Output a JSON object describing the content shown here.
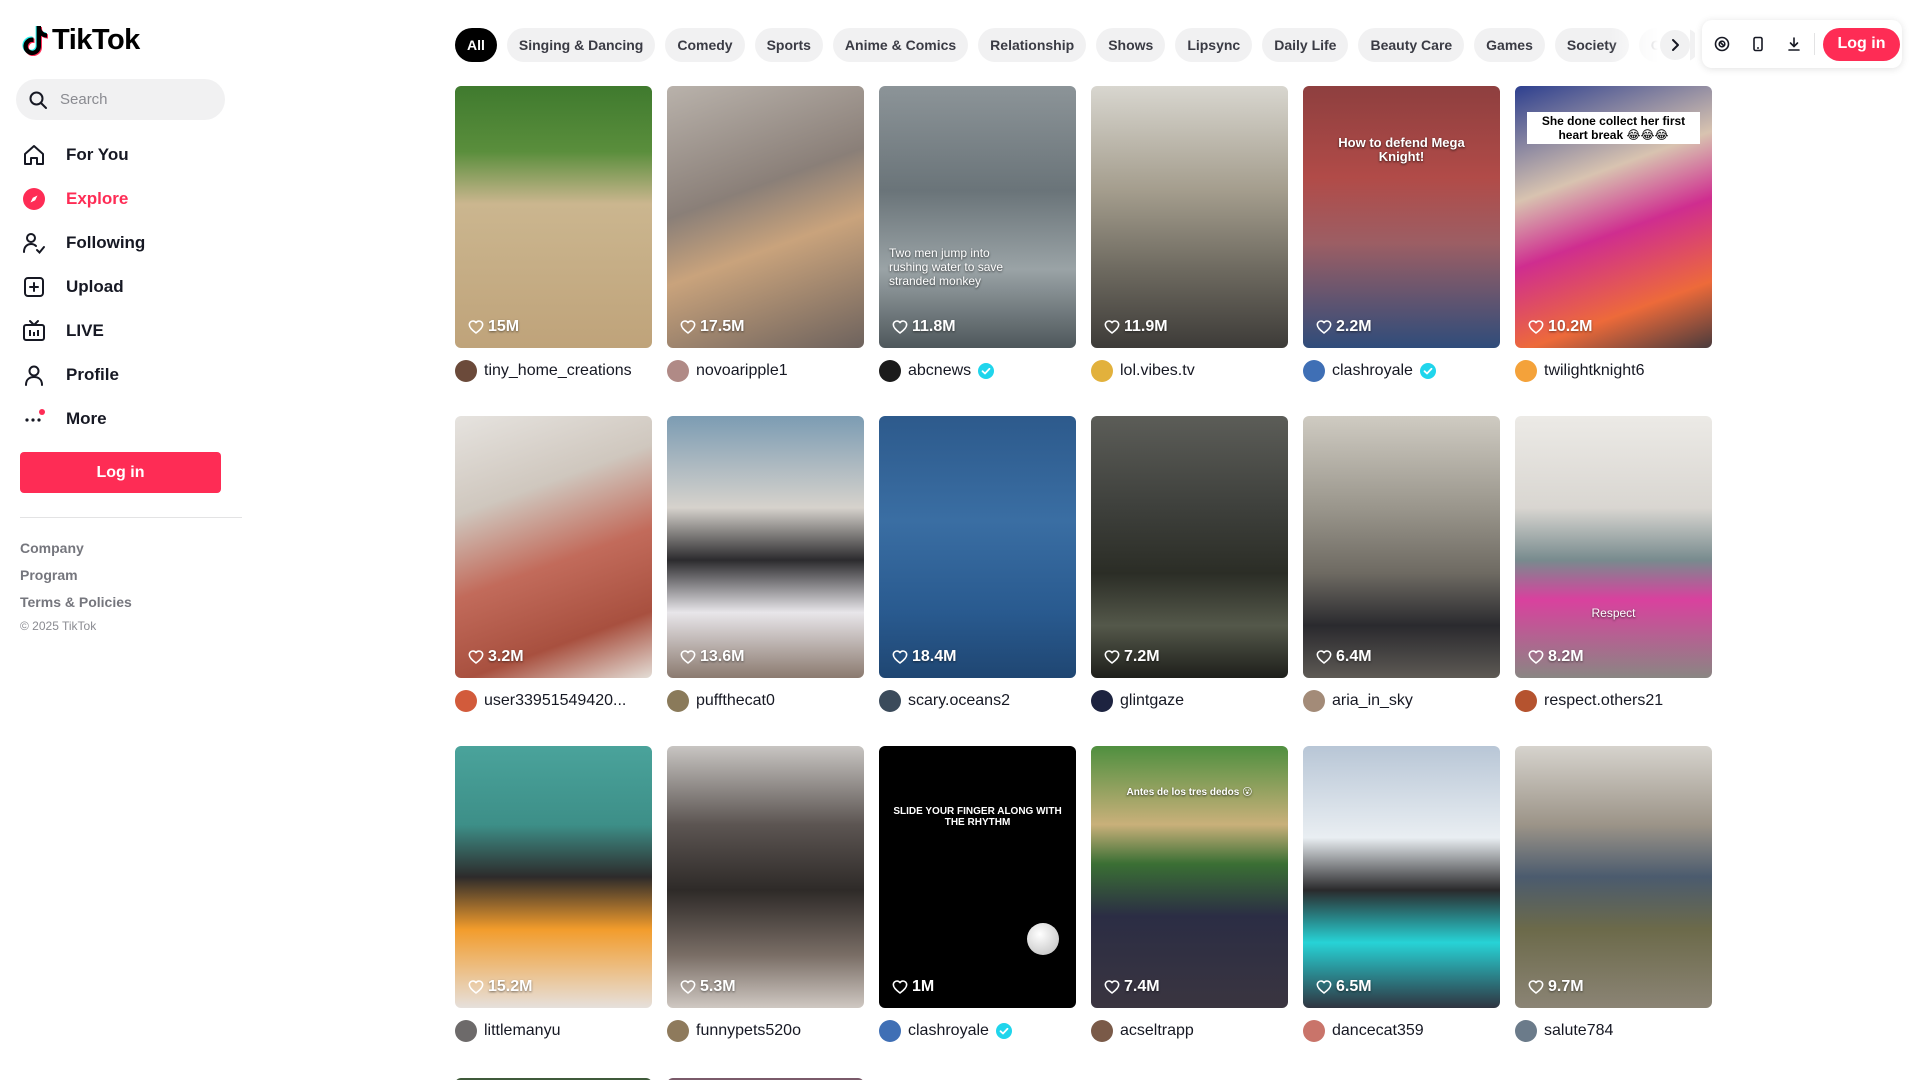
{
  "brand": {
    "name": "TikTok",
    "accent": "#fe2c55"
  },
  "search": {
    "placeholder": "Search"
  },
  "nav": [
    {
      "label": "For You",
      "icon": "home-icon",
      "active": false
    },
    {
      "label": "Explore",
      "icon": "compass-icon",
      "active": true
    },
    {
      "label": "Following",
      "icon": "following-icon",
      "active": false
    },
    {
      "label": "Upload",
      "icon": "upload-icon",
      "active": false
    },
    {
      "label": "LIVE",
      "icon": "live-icon",
      "active": false
    },
    {
      "label": "Profile",
      "icon": "profile-icon",
      "active": false
    },
    {
      "label": "More",
      "icon": "more-icon",
      "active": false
    }
  ],
  "sidebar": {
    "login_label": "Log in"
  },
  "footer": {
    "links": [
      "Company",
      "Program",
      "Terms & Policies"
    ],
    "copyright": "© 2025 TikTok"
  },
  "categories": [
    "All",
    "Singing & Dancing",
    "Comedy",
    "Sports",
    "Anime & Comics",
    "Relationship",
    "Shows",
    "Lipsync",
    "Daily Life",
    "Beauty Care",
    "Games",
    "Society",
    "Outfit"
  ],
  "active_category": "All",
  "header": {
    "login_label": "Log in"
  },
  "videos": [
    {
      "likes": "15M",
      "author": "tiny_home_creations",
      "verified": false,
      "overlay": "",
      "bg": "linear-gradient(180deg,#3f7a2e 0%,#5a8e3c 25%,#cbb68f 45%,#bfa37a 100%)",
      "avatar": "#6b4a3a"
    },
    {
      "likes": "17.5M",
      "author": "novoaripple1",
      "verified": false,
      "overlay": "",
      "bg": "linear-gradient(160deg,#b9b2ab 0%,#8a7f78 40%,#c9a37c 60%,#6d625d 100%)",
      "avatar": "#b08a86"
    },
    {
      "likes": "11.8M",
      "author": "abcnews",
      "verified": true,
      "overlay": "Two men jump into rushing water to save stranded monkey",
      "bg": "linear-gradient(180deg,#8c9498 0%,#6a7479 40%,#9aa3a6 70%,#4e575b 100%)",
      "avatar": "#1b1b1b"
    },
    {
      "likes": "11.9M",
      "author": "lol.vibes.tv",
      "verified": false,
      "overlay": "",
      "bg": "linear-gradient(180deg,#d8d6cf 0%,#a49d8d 40%,#6e6a60 70%,#3d3b38 100%)",
      "avatar": "#e2b13c"
    },
    {
      "likes": "2.2M",
      "author": "clashroyale",
      "verified": true,
      "overlay": "How to defend Mega Knight!",
      "bg": "linear-gradient(180deg,#8e3f3f 0%,#b14b48 35%,#9c5e64 60%,#2f4c7a 100%)",
      "avatar": "#3f6fb5"
    },
    {
      "likes": "10.2M",
      "author": "twilightknight6",
      "verified": false,
      "overlay": "She done collect her first heart break 😂😂😂",
      "bg": "linear-gradient(160deg,#2d3f8f 0%,#d8c3b0 35%,#cf2d8f 55%,#ed6a3a 80%,#4a3b3d 100%)",
      "avatar": "#f4a23a"
    },
    {
      "likes": "3.2M",
      "author": "user33951549420...",
      "verified": false,
      "overlay": "",
      "bg": "linear-gradient(160deg,#e6e3df 0%,#cfc7be 30%,#c26b5b 55%,#a8503f 80%,#e3ddd6 100%)",
      "avatar": "#d25b3b"
    },
    {
      "likes": "13.6M",
      "author": "puffthecat0",
      "verified": false,
      "overlay": "",
      "bg": "linear-gradient(180deg,#7c9cb3 0%,#d6d2cc 35%,#2c2b2e 55%,#e8e6ea 75%,#8b7a6f 100%)",
      "avatar": "#8a7a5a"
    },
    {
      "likes": "18.4M",
      "author": "scary.oceans2",
      "verified": false,
      "overlay": "",
      "bg": "linear-gradient(180deg,#2d5a8c 0%,#3a6ea3 40%,#295a8f 75%,#1f4672 100%)",
      "avatar": "#3b4b5b"
    },
    {
      "likes": "7.2M",
      "author": "glintgaze",
      "verified": false,
      "overlay": "",
      "bg": "linear-gradient(180deg,#5c5d58 0%,#3e403c 35%,#2b2d26 60%,#54584a 80%,#1e1f1b 100%)",
      "avatar": "#1d2340"
    },
    {
      "likes": "6.4M",
      "author": "aria_in_sky",
      "verified": false,
      "overlay": "",
      "bg": "linear-gradient(180deg,#cfcbc2 0%,#9a968c 35%,#6e6a62 60%,#2a2a2e 80%,#5d5954 100%)",
      "avatar": "#a38b78"
    },
    {
      "likes": "8.2M",
      "author": "respect.others21",
      "verified": false,
      "overlay": "Respect",
      "bg": "linear-gradient(180deg,#eceae6 0%,#d9d6d1 35%,#788b8e 55%,#d9419e 70%,#8a8683 100%)",
      "avatar": "#b5532f"
    },
    {
      "likes": "15.2M",
      "author": "littlemanyu",
      "verified": false,
      "overlay": "",
      "bg": "linear-gradient(180deg,#4aa39b 0%,#3d8f88 30%,#2d2b2b 50%,#f29c2c 70%,#e6e0dc 100%)",
      "avatar": "#6d6a6a"
    },
    {
      "likes": "5.3M",
      "author": "funnypets520o",
      "verified": false,
      "overlay": "",
      "bg": "linear-gradient(180deg,#c8c5c2 0%,#5c5552 30%,#2e2a28 55%,#7a6e66 80%,#cfc8c2 100%)",
      "avatar": "#8e7a5c"
    },
    {
      "likes": "1M",
      "author": "clashroyale",
      "verified": true,
      "overlay": "SLIDE YOUR FINGER ALONG WITH THE RHYTHM",
      "bg": "#000000",
      "avatar": "#3f6fb5"
    },
    {
      "likes": "7.4M",
      "author": "acseltrapp",
      "verified": false,
      "overlay": "Antes de los tres dedos 😮",
      "bg": "linear-gradient(180deg,#4f8f3f 0%,#c9b07a 30%,#3a6f34 45%,#2b2d44 65%,#3a3540 100%)",
      "avatar": "#7a5a48"
    },
    {
      "likes": "6.5M",
      "author": "dancecat359",
      "verified": false,
      "overlay": "",
      "bg": "linear-gradient(180deg,#b8c6d6 0%,#e9eef2 35%,#2a2a2c 55%,#27d3d6 75%,#2f3440 100%)",
      "avatar": "#c9746a"
    },
    {
      "likes": "9.7M",
      "author": "salute784",
      "verified": false,
      "overlay": "",
      "bg": "linear-gradient(180deg,#d6d3cd 0%,#9c9488 30%,#4b5b6e 50%,#6c6a4a 70%,#8b8475 100%)",
      "avatar": "#6b7b8a"
    }
  ],
  "partial_row": [
    "#3f5a3a",
    "#7a5a6a"
  ]
}
